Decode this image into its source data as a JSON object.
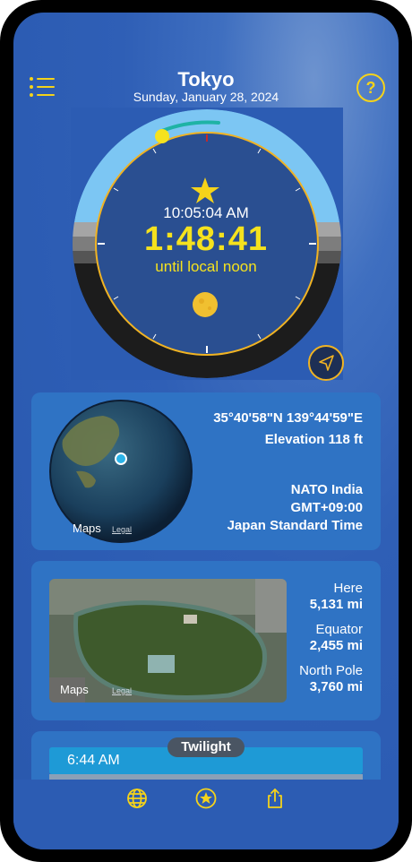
{
  "header": {
    "title": "Tokyo",
    "date": "Sunday, January 28, 2024"
  },
  "clock": {
    "local_time": "10:05:04 AM",
    "countdown": "1:48:41",
    "countdown_label": "until local noon"
  },
  "location_card": {
    "coordinates": "35°40'58\"N 139°44'59\"E",
    "elevation": "Elevation 118 ft",
    "nato_zone": "NATO India",
    "gmt_offset": "GMT+09:00",
    "timezone_name": "Japan Standard Time",
    "maps_label": "Maps",
    "legal_label": "Legal"
  },
  "distance_card": {
    "items": [
      {
        "label": "Here",
        "value": "5,131 mi"
      },
      {
        "label": "Equator",
        "value": "2,455 mi"
      },
      {
        "label": "North Pole",
        "value": "3,760 mi"
      }
    ],
    "maps_label": "Maps",
    "legal_label": "Legal"
  },
  "twilight_card": {
    "pill": "Twilight",
    "time": "6:44 AM"
  },
  "tabbar": {
    "icons": [
      "globe-icon",
      "star-icon",
      "share-icon"
    ]
  },
  "colors": {
    "accent": "#f5d31a",
    "card": "#2f73c4",
    "sky": "#2c5cb3"
  }
}
